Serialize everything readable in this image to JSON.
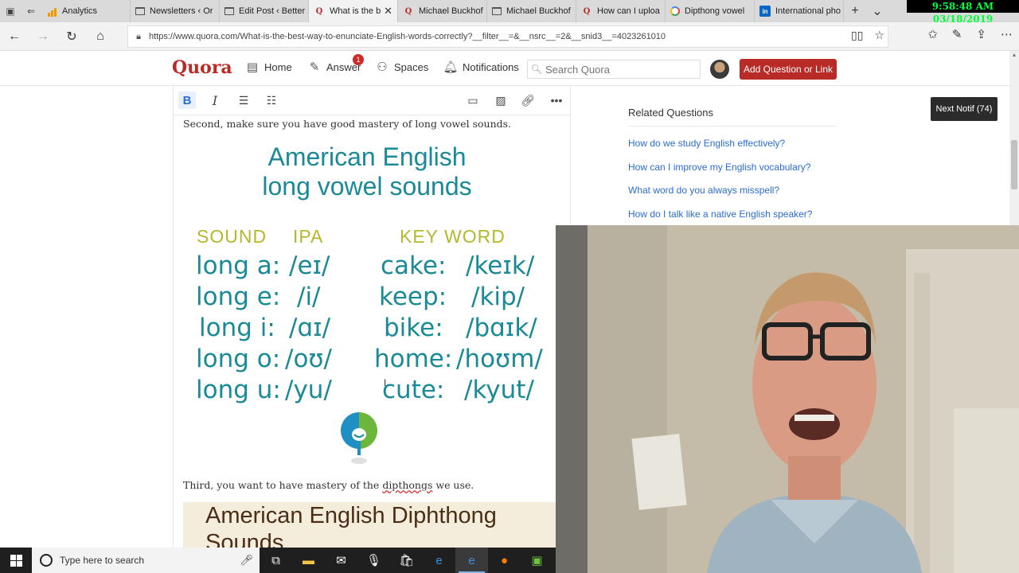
{
  "clock": "9:58:48 AM 03/18/2019",
  "tabs": [
    {
      "label": "Analytics",
      "icon": "analytics-bars-icon",
      "active": false
    },
    {
      "label": "Newsletters ‹ Or",
      "icon": "page-icon",
      "active": false
    },
    {
      "label": "Edit Post ‹ Better",
      "icon": "page-icon",
      "active": false
    },
    {
      "label": "What is the b",
      "icon": "quora-q-icon",
      "active": true
    },
    {
      "label": "Michael Buckhof",
      "icon": "quora-q-icon",
      "active": false
    },
    {
      "label": "Michael Buckhof",
      "icon": "page-icon",
      "active": false
    },
    {
      "label": "How can I uploa",
      "icon": "quora-q-icon",
      "active": false
    },
    {
      "label": "Dipthong vowel",
      "icon": "google-g-icon",
      "active": false
    },
    {
      "label": "International pho",
      "icon": "linkedin-icon",
      "active": false
    }
  ],
  "address": {
    "url": "https://www.quora.com/What-is-the-best-way-to-enunciate-English-words-correctly?__filter__=&__nsrc__=2&__snid3__=4023261010"
  },
  "quora": {
    "logo": "Quora",
    "nav": {
      "home": "Home",
      "answer": "Answer",
      "answer_badge": "1",
      "spaces": "Spaces",
      "notifications": "Notifications"
    },
    "search_placeholder": "Search Quora",
    "add_question": "Add Question or Link"
  },
  "editor": {
    "para_long_vowels": "Second, make sure you have good mastery of long vowel sounds.",
    "para_diphthongs_before": "Third, you want to have mastery of the ",
    "para_diphthongs_link": "dipthongs",
    "para_diphthongs_after": " we use."
  },
  "vowel_image": {
    "title_line1": "American English",
    "title_line2": "long vowel sounds",
    "header_sound": "SOUND",
    "header_ipa": "IPA",
    "header_keyword": "KEY WORD",
    "rows": [
      {
        "sound": "long a:",
        "ipa": "/eɪ/",
        "word": "cake:",
        "word_ipa": "/keɪk/"
      },
      {
        "sound": "long e:",
        "ipa": "/i/",
        "word": "keep:",
        "word_ipa": "/kip/"
      },
      {
        "sound": "long i:",
        "ipa": "/ɑɪ/",
        "word": "bike:",
        "word_ipa": "/bɑɪk/"
      },
      {
        "sound": "long o:",
        "ipa": "/oʊ/",
        "word": "home:",
        "word_ipa": "/hoʊm/"
      },
      {
        "sound": "long u:",
        "ipa": "/yu/",
        "word": "cute:",
        "word_ipa": "/kyut/"
      }
    ]
  },
  "diphthong_image": {
    "title": "American English Diphthong Sounds"
  },
  "related": {
    "heading": "Related Questions",
    "links": [
      "How do we study English effectively?",
      "How can I improve my English vocabulary?",
      "What word do you always misspell?",
      "How do I talk like a native English speaker?"
    ]
  },
  "next_notif": "Next Notif (74)",
  "taskbar": {
    "search_placeholder": "Type here to search"
  },
  "colors": {
    "quora_red": "#b92b27",
    "link_blue": "#2b6dd1",
    "vowel_teal": "#1a8a96",
    "vowel_header_olive": "#b5b82e",
    "clock_green": "#00ff3c"
  }
}
